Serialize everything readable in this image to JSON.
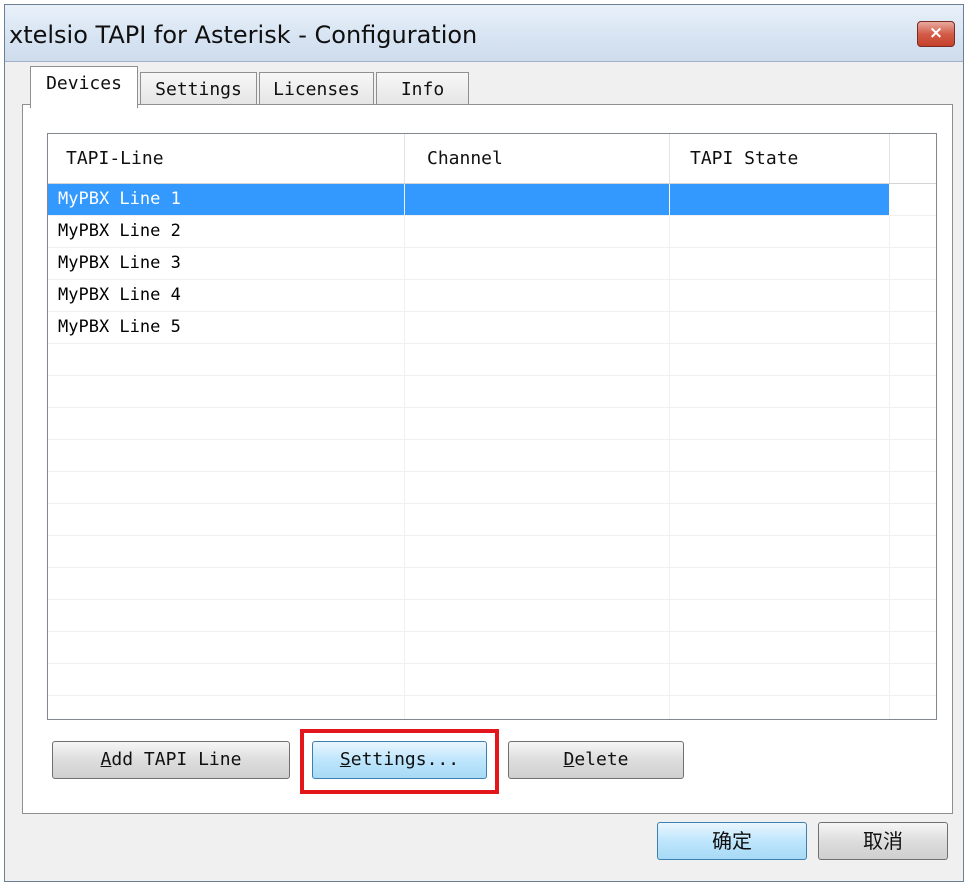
{
  "window": {
    "title": "xtelsio TAPI for Asterisk - Configuration",
    "close_label": "×"
  },
  "tabs": [
    {
      "label": "Devices",
      "active": true
    },
    {
      "label": "Settings",
      "active": false
    },
    {
      "label": "Licenses",
      "active": false
    },
    {
      "label": "Info",
      "active": false
    }
  ],
  "table": {
    "columns": [
      "TAPI-Line",
      "Channel",
      "TAPI State"
    ],
    "rows": [
      {
        "line": "MyPBX Line 1",
        "channel": "",
        "state": "",
        "selected": true
      },
      {
        "line": "MyPBX Line 2",
        "channel": "",
        "state": ""
      },
      {
        "line": "MyPBX Line 3",
        "channel": "",
        "state": ""
      },
      {
        "line": "MyPBX Line 4",
        "channel": "",
        "state": ""
      },
      {
        "line": "MyPBX Line 5",
        "channel": "",
        "state": ""
      }
    ],
    "selection_color": "#3399ff"
  },
  "buttons": {
    "add": {
      "mnemonic": "A",
      "rest": "dd TAPI Line"
    },
    "settings": {
      "mnemonic": "S",
      "rest": "ettings..."
    },
    "delete": {
      "mnemonic": "D",
      "rest": "elete"
    }
  },
  "dialog": {
    "ok_label": "确定",
    "cancel_label": "取消"
  },
  "highlight_color": "#e3161c"
}
